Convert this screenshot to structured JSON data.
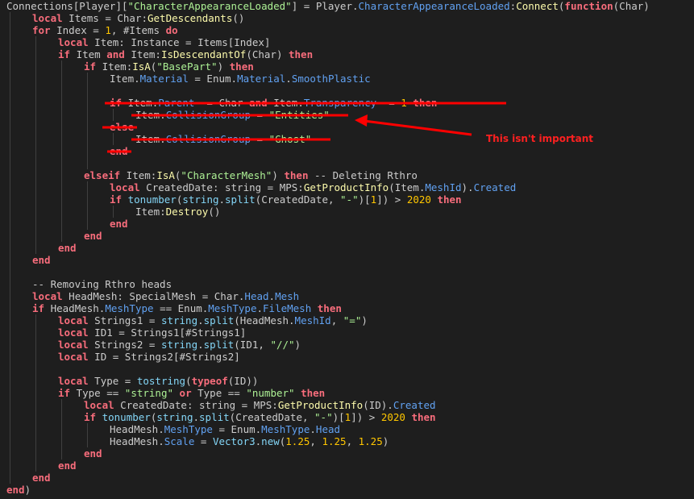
{
  "colors": {
    "background": "#1e1e1e",
    "keyword": "#f86d7c",
    "string": "#adf195",
    "number": "#ffc600",
    "property": "#61a1f1",
    "function": "#fdfbac",
    "default": "#cccccc",
    "annotation": "#ff0000"
  },
  "annotation": {
    "text": "This isn't important"
  },
  "code": [
    {
      "indent": 0,
      "tokens": [
        [
          "Connections[Player][",
          "default"
        ],
        [
          "\"CharacterAppearanceLoaded\"",
          "str"
        ],
        [
          "] = Player.",
          "default"
        ],
        [
          "CharacterAppearanceLoaded",
          "prop"
        ],
        [
          ":",
          "default"
        ],
        [
          "Connect",
          "func"
        ],
        [
          "(",
          "default"
        ],
        [
          "function",
          "kw"
        ],
        [
          "(Char)",
          "default"
        ]
      ]
    },
    {
      "indent": 1,
      "tokens": [
        [
          "local",
          "kw"
        ],
        [
          " Items = Char:",
          "default"
        ],
        [
          "GetDescendants",
          "func"
        ],
        [
          "()",
          "default"
        ]
      ]
    },
    {
      "indent": 1,
      "tokens": [
        [
          "for",
          "kw"
        ],
        [
          " Index = ",
          "default"
        ],
        [
          "1",
          "num"
        ],
        [
          ", #Items ",
          "default"
        ],
        [
          "do",
          "kw"
        ]
      ]
    },
    {
      "indent": 2,
      "tokens": [
        [
          "local",
          "kw"
        ],
        [
          " Item: Instance = Items[Index]",
          "default"
        ]
      ]
    },
    {
      "indent": 2,
      "tokens": [
        [
          "if",
          "kw"
        ],
        [
          " Item ",
          "default"
        ],
        [
          "and",
          "kw"
        ],
        [
          " Item:",
          "default"
        ],
        [
          "IsDescendantOf",
          "func"
        ],
        [
          "(Char) ",
          "default"
        ],
        [
          "then",
          "kw"
        ]
      ]
    },
    {
      "indent": 3,
      "tokens": [
        [
          "if",
          "kw"
        ],
        [
          " Item:",
          "default"
        ],
        [
          "IsA",
          "func"
        ],
        [
          "(",
          "default"
        ],
        [
          "\"BasePart\"",
          "str"
        ],
        [
          ") ",
          "default"
        ],
        [
          "then",
          "kw"
        ]
      ]
    },
    {
      "indent": 4,
      "tokens": [
        [
          "Item.",
          "default"
        ],
        [
          "Material",
          "prop"
        ],
        [
          " = Enum.",
          "default"
        ],
        [
          "Material",
          "prop"
        ],
        [
          ".",
          "default"
        ],
        [
          "SmoothPlastic",
          "prop"
        ]
      ]
    },
    {
      "indent": 4,
      "tokens": []
    },
    {
      "indent": 4,
      "tokens": [
        [
          "if",
          "kw"
        ],
        [
          " Item.",
          "default"
        ],
        [
          "Parent",
          "prop"
        ],
        [
          " ~= Char ",
          "default"
        ],
        [
          "and",
          "kw"
        ],
        [
          " Item.",
          "default"
        ],
        [
          "Transparency",
          "prop"
        ],
        [
          " ~= ",
          "default"
        ],
        [
          "1",
          "num"
        ],
        [
          " ",
          "default"
        ],
        [
          "then",
          "kw"
        ]
      ]
    },
    {
      "indent": 5,
      "tokens": [
        [
          "Item.",
          "default"
        ],
        [
          "CollisionGroup",
          "prop"
        ],
        [
          " = ",
          "default"
        ],
        [
          "\"Entities\"",
          "str"
        ]
      ]
    },
    {
      "indent": 4,
      "tokens": [
        [
          "else",
          "kw"
        ]
      ]
    },
    {
      "indent": 5,
      "tokens": [
        [
          "Item.",
          "default"
        ],
        [
          "CollisionGroup",
          "prop"
        ],
        [
          " = ",
          "default"
        ],
        [
          "\"Ghost\"",
          "str"
        ]
      ]
    },
    {
      "indent": 4,
      "tokens": [
        [
          "end",
          "kw"
        ]
      ]
    },
    {
      "indent": 4,
      "tokens": []
    },
    {
      "indent": 3,
      "tokens": [
        [
          "elseif",
          "kw"
        ],
        [
          " Item:",
          "default"
        ],
        [
          "IsA",
          "func"
        ],
        [
          "(",
          "default"
        ],
        [
          "\"CharacterMesh\"",
          "str"
        ],
        [
          ") ",
          "default"
        ],
        [
          "then",
          "kw"
        ],
        [
          " -- Deleting Rthro",
          "default"
        ]
      ]
    },
    {
      "indent": 4,
      "tokens": [
        [
          "local",
          "kw"
        ],
        [
          " CreatedDate: string = MPS:",
          "default"
        ],
        [
          "GetProductInfo",
          "func"
        ],
        [
          "(Item.",
          "default"
        ],
        [
          "MeshId",
          "prop"
        ],
        [
          ").",
          "default"
        ],
        [
          "Created",
          "prop"
        ]
      ]
    },
    {
      "indent": 4,
      "tokens": [
        [
          "if",
          "kw"
        ],
        [
          " ",
          "default"
        ],
        [
          "tonumber",
          "builtin"
        ],
        [
          "(",
          "default"
        ],
        [
          "string",
          "builtin"
        ],
        [
          ".",
          "default"
        ],
        [
          "split",
          "builtin"
        ],
        [
          "(CreatedDate, ",
          "default"
        ],
        [
          "\"-\"",
          "str"
        ],
        [
          ")[",
          "default"
        ],
        [
          "1",
          "num"
        ],
        [
          "]) > ",
          "default"
        ],
        [
          "2020",
          "num"
        ],
        [
          " ",
          "default"
        ],
        [
          "then",
          "kw"
        ]
      ]
    },
    {
      "indent": 5,
      "tokens": [
        [
          "Item:",
          "default"
        ],
        [
          "Destroy",
          "func"
        ],
        [
          "()",
          "default"
        ]
      ]
    },
    {
      "indent": 4,
      "tokens": [
        [
          "end",
          "kw"
        ]
      ]
    },
    {
      "indent": 3,
      "tokens": [
        [
          "end",
          "kw"
        ]
      ]
    },
    {
      "indent": 2,
      "tokens": [
        [
          "end",
          "kw"
        ]
      ]
    },
    {
      "indent": 1,
      "tokens": [
        [
          "end",
          "kw"
        ]
      ]
    },
    {
      "indent": 1,
      "tokens": []
    },
    {
      "indent": 1,
      "tokens": [
        [
          "-- Removing Rthro heads",
          "default"
        ]
      ]
    },
    {
      "indent": 1,
      "tokens": [
        [
          "local",
          "kw"
        ],
        [
          " HeadMesh: SpecialMesh = Char.",
          "default"
        ],
        [
          "Head",
          "prop"
        ],
        [
          ".",
          "default"
        ],
        [
          "Mesh",
          "prop"
        ]
      ]
    },
    {
      "indent": 1,
      "tokens": [
        [
          "if",
          "kw"
        ],
        [
          " HeadMesh.",
          "default"
        ],
        [
          "MeshType",
          "prop"
        ],
        [
          " == Enum.",
          "default"
        ],
        [
          "MeshType",
          "prop"
        ],
        [
          ".",
          "default"
        ],
        [
          "FileMesh",
          "prop"
        ],
        [
          " ",
          "default"
        ],
        [
          "then",
          "kw"
        ]
      ]
    },
    {
      "indent": 2,
      "tokens": [
        [
          "local",
          "kw"
        ],
        [
          " Strings1 = ",
          "default"
        ],
        [
          "string",
          "builtin"
        ],
        [
          ".",
          "default"
        ],
        [
          "split",
          "builtin"
        ],
        [
          "(HeadMesh.",
          "default"
        ],
        [
          "MeshId",
          "prop"
        ],
        [
          ", ",
          "default"
        ],
        [
          "\"=\"",
          "str"
        ],
        [
          ")",
          "default"
        ]
      ]
    },
    {
      "indent": 2,
      "tokens": [
        [
          "local",
          "kw"
        ],
        [
          " ID1 = Strings1[#Strings1]",
          "default"
        ]
      ]
    },
    {
      "indent": 2,
      "tokens": [
        [
          "local",
          "kw"
        ],
        [
          " Strings2 = ",
          "default"
        ],
        [
          "string",
          "builtin"
        ],
        [
          ".",
          "default"
        ],
        [
          "split",
          "builtin"
        ],
        [
          "(ID1, ",
          "default"
        ],
        [
          "\"//\"",
          "str"
        ],
        [
          ")",
          "default"
        ]
      ]
    },
    {
      "indent": 2,
      "tokens": [
        [
          "local",
          "kw"
        ],
        [
          " ID = Strings2[#Strings2]",
          "default"
        ]
      ]
    },
    {
      "indent": 2,
      "tokens": []
    },
    {
      "indent": 2,
      "tokens": [
        [
          "local",
          "kw"
        ],
        [
          " Type = ",
          "default"
        ],
        [
          "tostring",
          "builtin"
        ],
        [
          "(",
          "default"
        ],
        [
          "typeof",
          "kw"
        ],
        [
          "(ID))",
          "default"
        ]
      ]
    },
    {
      "indent": 2,
      "tokens": [
        [
          "if",
          "kw"
        ],
        [
          " Type == ",
          "default"
        ],
        [
          "\"string\"",
          "str"
        ],
        [
          " ",
          "default"
        ],
        [
          "or",
          "kw"
        ],
        [
          " Type == ",
          "default"
        ],
        [
          "\"number\"",
          "str"
        ],
        [
          " ",
          "default"
        ],
        [
          "then",
          "kw"
        ]
      ]
    },
    {
      "indent": 3,
      "tokens": [
        [
          "local",
          "kw"
        ],
        [
          " CreatedDate: string = MPS:",
          "default"
        ],
        [
          "GetProductInfo",
          "func"
        ],
        [
          "(ID).",
          "default"
        ],
        [
          "Created",
          "prop"
        ]
      ]
    },
    {
      "indent": 3,
      "tokens": [
        [
          "if",
          "kw"
        ],
        [
          " ",
          "default"
        ],
        [
          "tonumber",
          "builtin"
        ],
        [
          "(",
          "default"
        ],
        [
          "string",
          "builtin"
        ],
        [
          ".",
          "default"
        ],
        [
          "split",
          "builtin"
        ],
        [
          "(CreatedDate, ",
          "default"
        ],
        [
          "\"-\"",
          "str"
        ],
        [
          ")[",
          "default"
        ],
        [
          "1",
          "num"
        ],
        [
          "]) > ",
          "default"
        ],
        [
          "2020",
          "num"
        ],
        [
          " ",
          "default"
        ],
        [
          "then",
          "kw"
        ]
      ]
    },
    {
      "indent": 4,
      "tokens": [
        [
          "HeadMesh.",
          "default"
        ],
        [
          "MeshType",
          "prop"
        ],
        [
          " = Enum.",
          "default"
        ],
        [
          "MeshType",
          "prop"
        ],
        [
          ".",
          "default"
        ],
        [
          "Head",
          "prop"
        ]
      ]
    },
    {
      "indent": 4,
      "tokens": [
        [
          "HeadMesh.",
          "default"
        ],
        [
          "Scale",
          "prop"
        ],
        [
          " = ",
          "default"
        ],
        [
          "Vector3",
          "builtin"
        ],
        [
          ".",
          "default"
        ],
        [
          "new",
          "builtin"
        ],
        [
          "(",
          "default"
        ],
        [
          "1.25",
          "num"
        ],
        [
          ", ",
          "default"
        ],
        [
          "1.25",
          "num"
        ],
        [
          ", ",
          "default"
        ],
        [
          "1.25",
          "num"
        ],
        [
          ")",
          "default"
        ]
      ]
    },
    {
      "indent": 3,
      "tokens": [
        [
          "end",
          "kw"
        ]
      ]
    },
    {
      "indent": 2,
      "tokens": [
        [
          "end",
          "kw"
        ]
      ]
    },
    {
      "indent": 1,
      "tokens": [
        [
          "end",
          "kw"
        ]
      ]
    },
    {
      "indent": 0,
      "tokens": [
        [
          "end",
          "kw"
        ],
        [
          ")",
          "default"
        ]
      ]
    }
  ]
}
